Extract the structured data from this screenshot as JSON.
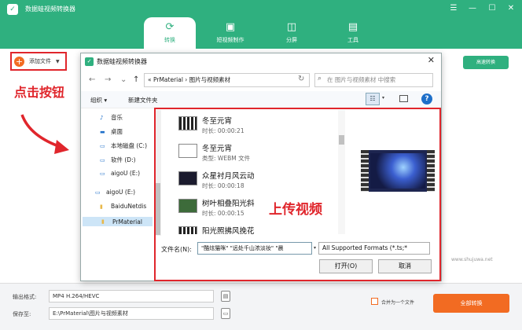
{
  "app": {
    "title": "数据蛙视频转换器",
    "logo": "✓"
  },
  "window_controls": {
    "menu": "☰",
    "minimize": "—",
    "maximize": "☐",
    "close": "✕"
  },
  "nav_tabs": [
    {
      "label": "转换",
      "icon": "convert-icon",
      "glyph": "⟳",
      "active": true
    },
    {
      "label": "短视频制作",
      "icon": "video-edit-icon",
      "glyph": "▣",
      "active": false
    },
    {
      "label": "分屏",
      "icon": "split-screen-icon",
      "glyph": "◫",
      "active": false
    },
    {
      "label": "工具",
      "icon": "toolbox-icon",
      "glyph": "▤",
      "active": false
    }
  ],
  "toolbar": {
    "add_file": "添加文件",
    "add_icon": "+",
    "caret": "▼",
    "convert_top": "高速转换"
  },
  "annotations": {
    "click_button": "点击按钮",
    "upload_video": "上传视频"
  },
  "watermark": "www.shujuwa.net",
  "bottom": {
    "format_label": "输出格式:",
    "format_value": "MP4 H.264/HEVC",
    "save_label": "保存至:",
    "save_path": "E:\\PrMaterial\\图片与视频素材",
    "merge_label": "合并为一个文件",
    "convert_all": "全部转换"
  },
  "dialog": {
    "title": "数据蛙视频转换器",
    "logo": "✓",
    "close": "✕",
    "nav": {
      "back": "←",
      "forward": "→",
      "recent": "⌄",
      "up": "↑",
      "refresh": "↻"
    },
    "breadcrumb": "« PrMaterial › 图片与视频素材",
    "search_placeholder": "在 图片与视频素材 中搜索",
    "search_icon": "⌕",
    "organize": "组织 ▾",
    "new_folder": "新建文件夹",
    "view_glyph": "☷",
    "view_caret": "▾",
    "help": "?",
    "tree": [
      {
        "label": "音乐",
        "icon": "♪"
      },
      {
        "label": "桌面",
        "icon": "▬"
      },
      {
        "label": "本地磁盘 (C:)",
        "icon": "▭"
      },
      {
        "label": "软件 (D:)",
        "icon": "▭"
      },
      {
        "label": "aigoU (E:)",
        "icon": "▭"
      },
      {
        "label": "aigoU (E:)",
        "icon": "▭"
      },
      {
        "label": "BaiduNetdis",
        "icon": "▮"
      },
      {
        "label": "PrMaterial",
        "icon": "▮"
      }
    ],
    "files": [
      {
        "name": "冬至元宵",
        "meta": "时长: 00:00:21"
      },
      {
        "name": "冬至元宵",
        "meta": "类型: WEBM 文件"
      },
      {
        "name": "众星衬月风云动",
        "meta": "时长: 00:00:18"
      },
      {
        "name": "树叶相叠阳光斜",
        "meta": "时长: 00:00:15"
      },
      {
        "name": "阳光照拂风挽花",
        "meta": ""
      }
    ],
    "filename_label": "文件名(N):",
    "filename_value": "\"酷炫猫咪\" \"远处千山浓淡妆\" \"晨",
    "filetype": "All Supported Formats (*.ts;*",
    "open": "打开(O)",
    "cancel": "取消"
  }
}
